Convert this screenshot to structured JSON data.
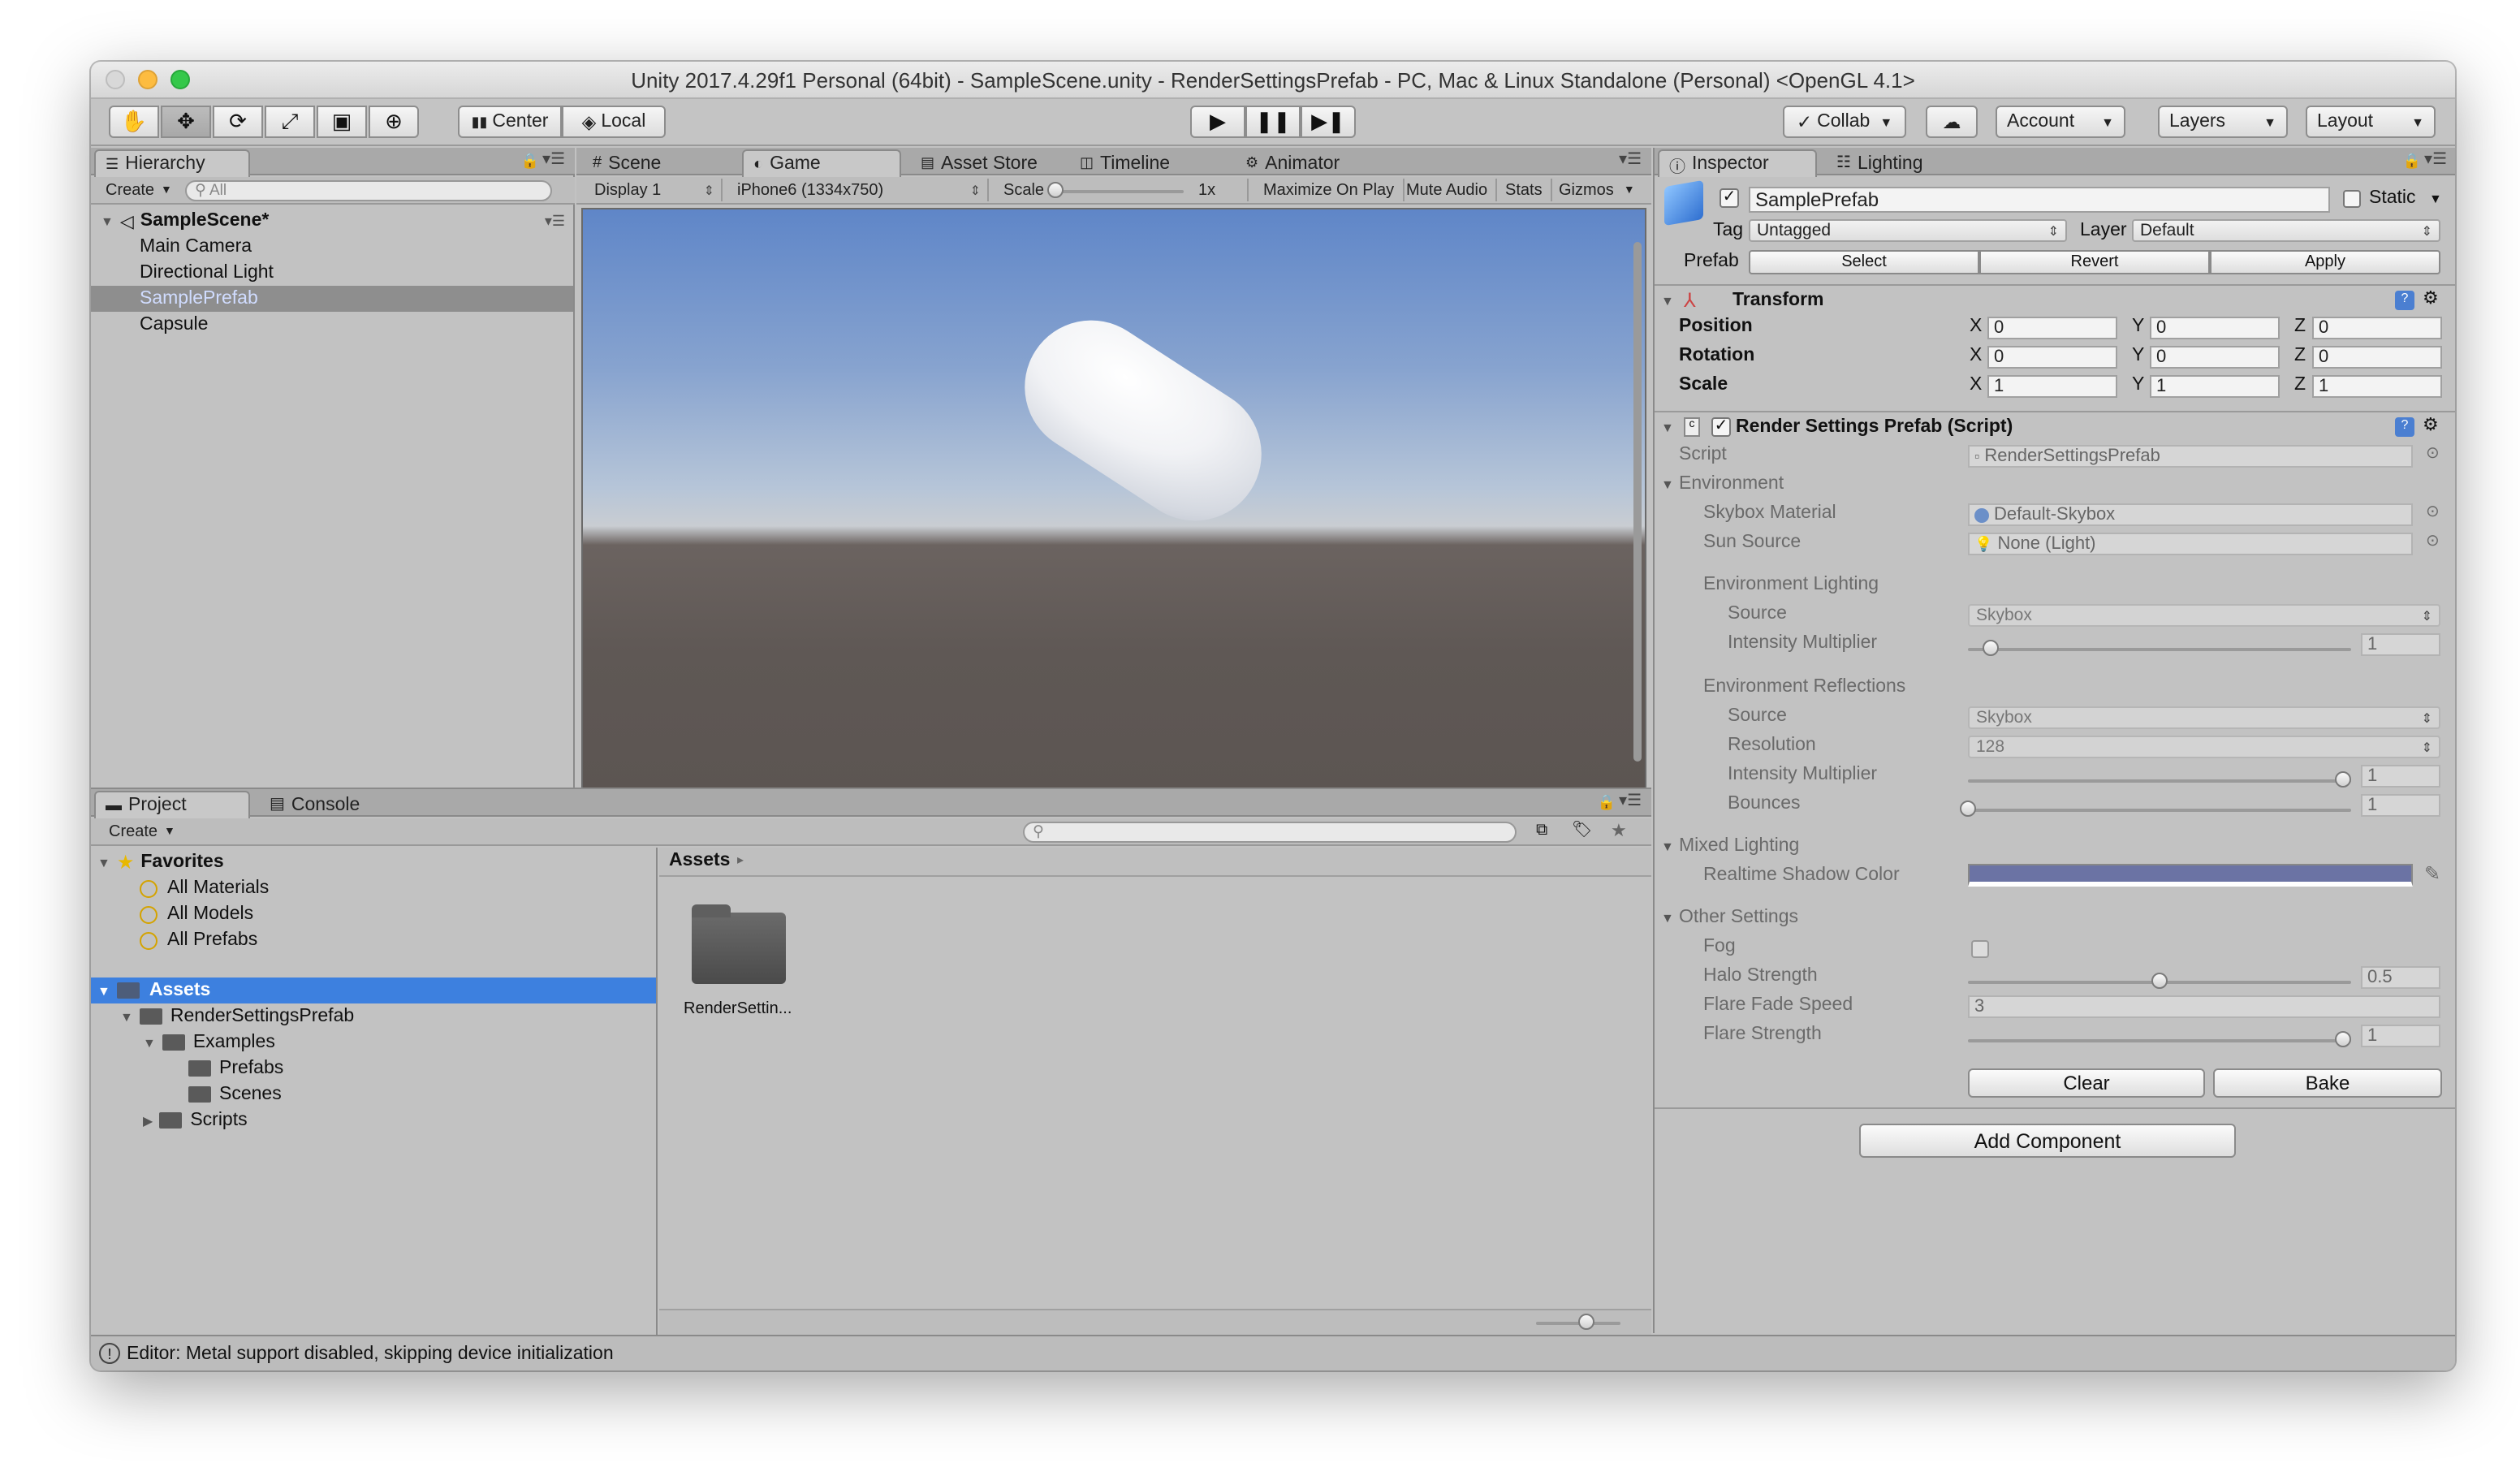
{
  "window": {
    "title": "Unity 2017.4.29f1 Personal (64bit) - SampleScene.unity - RenderSettingsPrefab - PC, Mac & Linux Standalone (Personal) <OpenGL 4.1>"
  },
  "colors": {
    "selection_blue": "#3d80df",
    "shadow_color": "#6b73a4",
    "sky_top": "#6d8fc9",
    "ground": "#5c5653"
  },
  "toolbar": {
    "tools": [
      "hand-icon",
      "move-icon",
      "rotate-icon",
      "scale-icon",
      "rect-icon",
      "transform-icon"
    ],
    "center_label": "Center",
    "local_label": "Local",
    "collab_label": "Collab",
    "account_label": "Account",
    "layers_label": "Layers",
    "layout_label": "Layout"
  },
  "hierarchy": {
    "tab": "Hierarchy",
    "create": "Create",
    "search_placeholder": "All",
    "scene": "SampleScene*",
    "items": [
      "Main Camera",
      "Directional Light",
      "SamplePrefab",
      "Capsule"
    ],
    "selected": "SamplePrefab"
  },
  "center": {
    "tabs": [
      "Scene",
      "Game",
      "Asset Store",
      "Timeline",
      "Animator"
    ],
    "active_tab": "Game",
    "display": "Display 1",
    "resolution": "iPhone6 (1334x750)",
    "scale_label": "Scale",
    "scale_value": "1x",
    "maximize": "Maximize On Play",
    "mute": "Mute Audio",
    "stats": "Stats",
    "gizmos": "Gizmos"
  },
  "project": {
    "tabs": [
      "Project",
      "Console"
    ],
    "create": "Create",
    "favorites_label": "Favorites",
    "favorites": [
      "All Materials",
      "All Models",
      "All Prefabs"
    ],
    "assets_label": "Assets",
    "tree": [
      "RenderSettingsPrefab",
      "Examples",
      "Prefabs",
      "Scenes",
      "Scripts"
    ],
    "breadcrumb": "Assets",
    "folder_item": "RenderSettin..."
  },
  "status": {
    "message": "Editor: Metal support disabled, skipping device initialization"
  },
  "inspector": {
    "tabs": [
      "Inspector",
      "Lighting"
    ],
    "object_name": "SamplePrefab",
    "static_label": "Static",
    "tag_label": "Tag",
    "tag_value": "Untagged",
    "layer_label": "Layer",
    "layer_value": "Default",
    "prefab_label": "Prefab",
    "prefab_buttons": [
      "Select",
      "Revert",
      "Apply"
    ],
    "transform": {
      "title": "Transform",
      "rows": [
        {
          "label": "Position",
          "x": "0",
          "y": "0",
          "z": "0"
        },
        {
          "label": "Rotation",
          "x": "0",
          "y": "0",
          "z": "0"
        },
        {
          "label": "Scale",
          "x": "1",
          "y": "1",
          "z": "1"
        }
      ]
    },
    "script_component": {
      "title": "Render Settings Prefab (Script)",
      "script_label": "Script",
      "script_value": "RenderSettingsPrefab",
      "environment": "Environment",
      "skybox_label": "Skybox Material",
      "skybox_value": "Default-Skybox",
      "sun_label": "Sun Source",
      "sun_value": "None (Light)",
      "env_lighting": "Environment Lighting",
      "source_label": "Source",
      "source_value": "Skybox",
      "intensity_label": "Intensity Multiplier",
      "intensity_value": "1",
      "intensity_level": 0.06,
      "env_reflections": "Environment Reflections",
      "refl_source_label": "Source",
      "refl_source_value": "Skybox",
      "resolution_label": "Resolution",
      "resolution_value": "128",
      "refl_intensity_label": "Intensity Multiplier",
      "refl_intensity_value": "1",
      "refl_intensity_level": 0.98,
      "bounces_label": "Bounces",
      "bounces_value": "1",
      "bounces_level": 0.0,
      "mixed_lighting": "Mixed Lighting",
      "shadow_color_label": "Realtime Shadow Color",
      "other_settings": "Other Settings",
      "fog_label": "Fog",
      "halo_label": "Halo Strength",
      "halo_value": "0.5",
      "halo_level": 0.5,
      "flare_fade_label": "Flare Fade Speed",
      "flare_fade_value": "3",
      "flare_strength_label": "Flare Strength",
      "flare_strength_value": "1",
      "flare_strength_level": 0.98,
      "clear_label": "Clear",
      "bake_label": "Bake"
    },
    "add_component": "Add Component"
  }
}
